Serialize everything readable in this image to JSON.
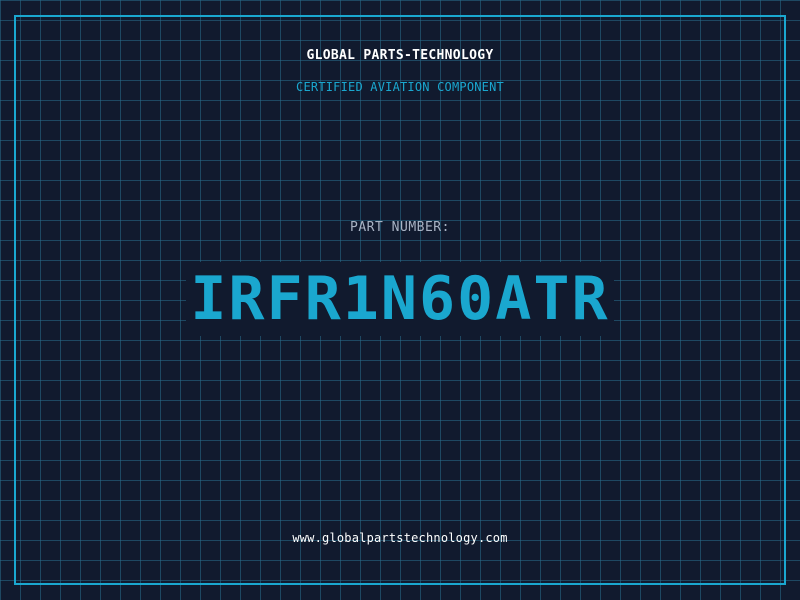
{
  "header": {
    "company": "GLOBAL PARTS-TECHNOLOGY",
    "tagline": "CERTIFIED AVIATION COMPONENT"
  },
  "part": {
    "label": "PART NUMBER:",
    "number": "IRFR1N60ATR"
  },
  "footer": {
    "website": "www.globalpartstechnology.com"
  },
  "colors": {
    "background": "#111a2e",
    "grid": "#286e8c",
    "accent": "#1aa7cf",
    "text": "#ffffff",
    "muted": "#a9b3c4"
  }
}
